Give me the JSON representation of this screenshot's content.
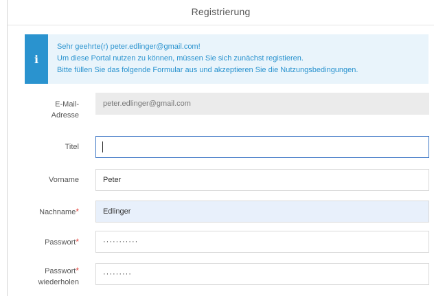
{
  "dialog": {
    "title": "Registrierung"
  },
  "info": {
    "icon": "info-icon",
    "icon_glyph": "i",
    "line1": "Sehr geehrte(r) peter.edlinger@gmail.com!",
    "line2": "Um diese Portal nutzen zu können, müssen Sie sich zunächst registieren.",
    "line3": "Bitte füllen Sie das folgende Formular aus und akzeptieren Sie die Nutzungsbedingungen."
  },
  "form": {
    "email": {
      "label_line1": "E-Mail-",
      "label_line2": "Adresse",
      "value": "peter.edlinger@gmail.com"
    },
    "title": {
      "label": "Titel",
      "value": ""
    },
    "firstname": {
      "label": "Vorname",
      "value": "Peter"
    },
    "lastname": {
      "label": "Nachname",
      "required_mark": "*",
      "value": "Edlinger"
    },
    "password": {
      "label": "Passwort",
      "required_mark": "*",
      "value": "···········"
    },
    "password_repeat": {
      "label_line1": "Passwort",
      "label_line2": "wiederholen",
      "required_mark": "*",
      "value": "·········"
    }
  },
  "colors": {
    "accent": "#2a93cf",
    "required": "#e2403a",
    "focus_border": "#3a74c4"
  }
}
